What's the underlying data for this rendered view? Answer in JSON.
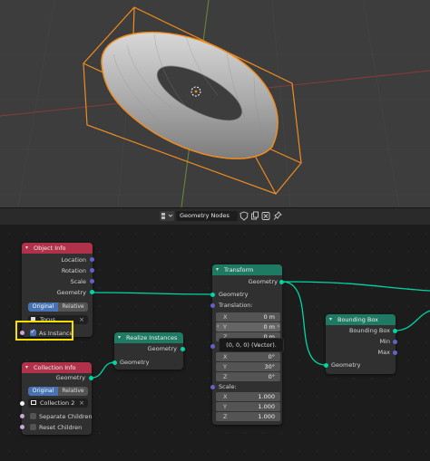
{
  "header": {
    "editor_name": "Geometry Nodes"
  },
  "nodes": {
    "object_info": {
      "title": "Object Info",
      "outputs": [
        "Location",
        "Rotation",
        "Scale",
        "Geometry"
      ],
      "mode_options": [
        "Original",
        "Relative"
      ],
      "mode_selected": "Original",
      "object_value": "Torus",
      "as_instance_label": "As Instance",
      "as_instance_checked": true
    },
    "collection_info": {
      "title": "Collection Info",
      "output": "Geometry",
      "mode_options": [
        "Original",
        "Relative"
      ],
      "mode_selected": "Original",
      "collection_value": "Collection 2",
      "separate_children_label": "Separate Children",
      "separate_children_checked": false,
      "reset_children_label": "Reset Children",
      "reset_children_checked": false
    },
    "realize_instances": {
      "title": "Realize Instances",
      "output": "Geometry",
      "input": "Geometry"
    },
    "transform": {
      "title": "Transform",
      "output": "Geometry",
      "input": "Geometry",
      "translation_label": "Translation:",
      "translation": {
        "x": "0 m",
        "y": "0 m",
        "z": "0 m"
      },
      "rotation": {
        "x": "0°",
        "y": "30°",
        "z": "0°"
      },
      "scale_label": "Scale:",
      "scale": {
        "x": "1.000",
        "y": "1.000",
        "z": "1.000"
      },
      "axis_labels": {
        "x": "X",
        "y": "Y",
        "z": "Z"
      }
    },
    "bounding_box": {
      "title": "Bounding Box",
      "outputs": [
        "Bounding Box",
        "Min",
        "Max"
      ],
      "input": "Geometry"
    }
  },
  "tooltip": "(0, 0, 0) (Vector).",
  "colors": {
    "geometry_socket": "#00d6a3",
    "vector_socket": "#6363c7",
    "boolean_socket": "#cca6d6",
    "input_header": "#b0324a",
    "geometry_header": "#1e7a63",
    "selection_outline": "#f08c1e",
    "highlight": "#f7e000",
    "active_button": "#4772b3"
  }
}
